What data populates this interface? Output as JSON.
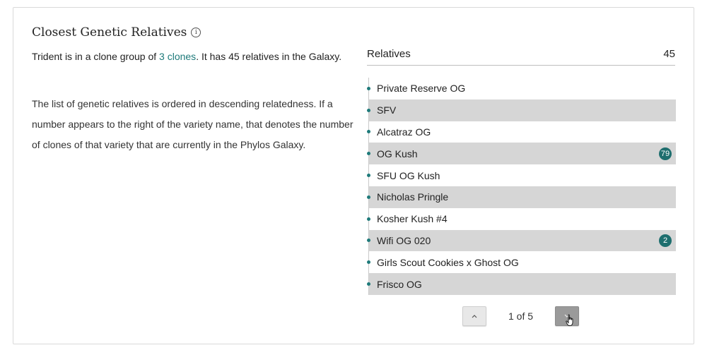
{
  "panel": {
    "title": "Closest Genetic Relatives",
    "info_icon": "info-icon"
  },
  "intro": {
    "prefix": "Trident is in a clone group of ",
    "link_text": "3 clones",
    "suffix": ". It has 45 relatives in the Galaxy."
  },
  "description": "The list of genetic relatives is ordered in descending relatedness. If a number appears to the right of the variety name, that denotes the number of clones of that variety that are currently in the Phylos Galaxy.",
  "relatives": {
    "header_label": "Relatives",
    "count": "45",
    "items": [
      {
        "name": "Private Reserve OG",
        "clones": ""
      },
      {
        "name": "SFV",
        "clones": ""
      },
      {
        "name": "Alcatraz OG",
        "clones": ""
      },
      {
        "name": "OG Kush",
        "clones": "79"
      },
      {
        "name": "SFU OG Kush",
        "clones": ""
      },
      {
        "name": "Nicholas Pringle",
        "clones": ""
      },
      {
        "name": "Kosher Kush #4",
        "clones": ""
      },
      {
        "name": "Wifi OG 020",
        "clones": "2"
      },
      {
        "name": "Girls Scout Cookies x Ghost OG",
        "clones": ""
      },
      {
        "name": "Frisco OG",
        "clones": ""
      }
    ]
  },
  "pagination": {
    "status": "1 of 5",
    "prev_icon": "chevron-up-icon",
    "next_icon": "chevron-down-icon"
  },
  "colors": {
    "accent": "#1e7a7a",
    "row_shade": "#d6d6d6"
  }
}
